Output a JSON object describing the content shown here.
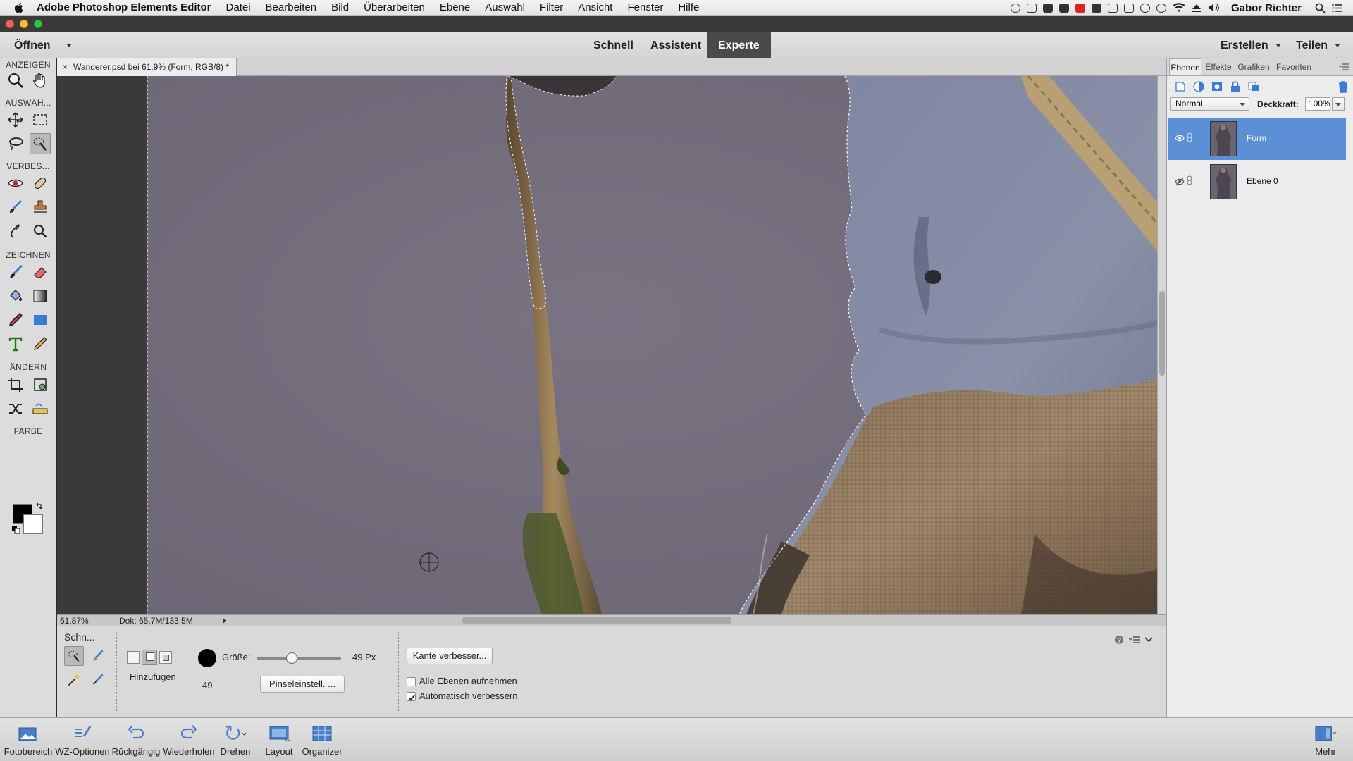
{
  "menubar": {
    "app_name": "Adobe Photoshop Elements Editor",
    "items": [
      "Datei",
      "Bearbeiten",
      "Bild",
      "Überarbeiten",
      "Ebene",
      "Auswahl",
      "Filter",
      "Ansicht",
      "Fenster",
      "Hilfe"
    ],
    "user": "Gabor Richter"
  },
  "modebar": {
    "open_label": "Öffnen",
    "modes": [
      "Schnell",
      "Assistent",
      "Experte"
    ],
    "active_mode": "Experte",
    "create_label": "Erstellen",
    "share_label": "Teilen"
  },
  "toolbox": {
    "sections": [
      "ANZEIGEN",
      "AUSWÄH...",
      "VERBES...",
      "ZEICHNEN",
      "ÄNDERN",
      "FARBE"
    ],
    "foreground_color": "#000000",
    "background_color": "#ffffff"
  },
  "document": {
    "tab_title": "Wanderer.psd bei 61,9% (Form, RGB/8) *",
    "close_glyph": "×",
    "zoom": "61,87%",
    "doc_info": "Dok: 65,7M/133,5M"
  },
  "options": {
    "tool_name": "Schn...",
    "mode_label": "Hinzufügen",
    "size_label": "Größe:",
    "size_value": "49 Px",
    "brush_size": "49",
    "size_fraction": 0.42,
    "brush_settings_label": "Pinseleinstell. ...",
    "refine_edge_label": "Kante verbesser...",
    "sample_all_layers_label": "Alle Ebenen aufnehmen",
    "sample_all_layers_checked": false,
    "auto_enhance_label": "Automatisch verbessern",
    "auto_enhance_checked": true
  },
  "layers_panel": {
    "tabs": [
      "Ebenen",
      "Effekte",
      "Grafiken",
      "Favoriten"
    ],
    "active_tab": "Ebenen",
    "blend_mode": "Normal",
    "opacity_label": "Deckkraft:",
    "opacity_value": "100%",
    "layers": [
      {
        "name": "Form",
        "selected": true,
        "visible": true
      },
      {
        "name": "Ebene 0",
        "selected": false,
        "visible": false
      }
    ],
    "selected_color": "#5b8fd6"
  },
  "taskbar": {
    "items": [
      "Fotobereich",
      "WZ-Optionen",
      "Rückgängig",
      "Wiederholen",
      "Drehen",
      "Layout",
      "Organizer"
    ],
    "more_label": "Mehr"
  }
}
